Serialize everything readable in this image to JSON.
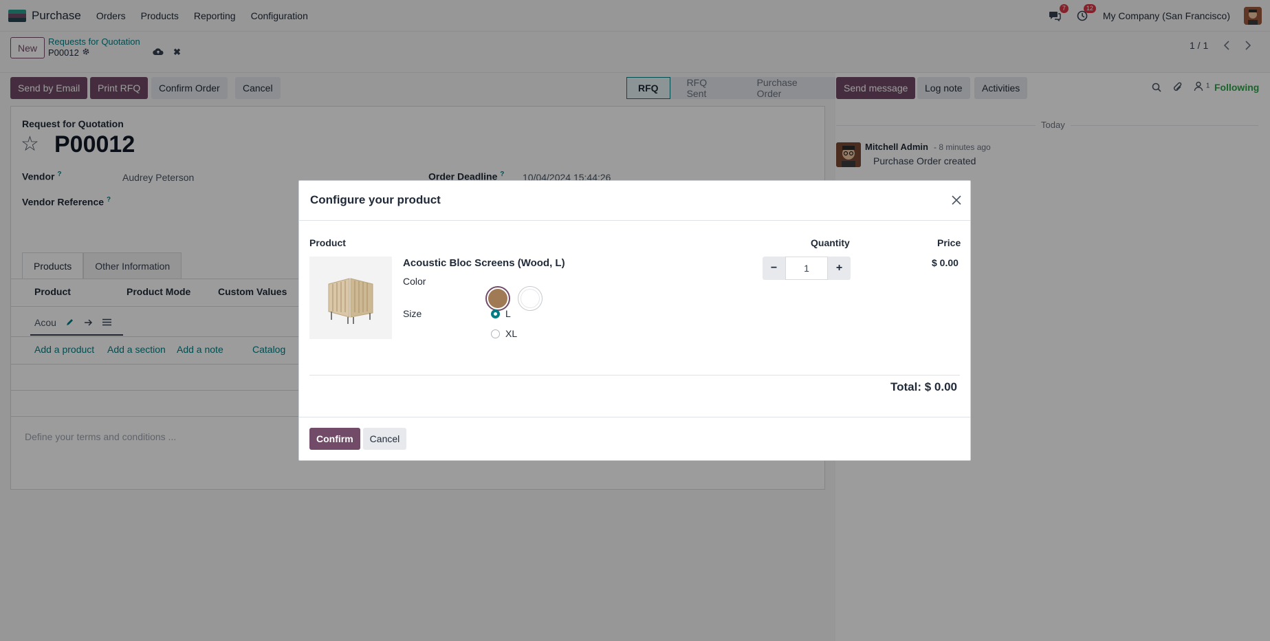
{
  "navbar": {
    "app_name": "Purchase",
    "menu": [
      "Orders",
      "Products",
      "Reporting",
      "Configuration"
    ],
    "messages_badge": "7",
    "activities_badge": "12",
    "company": "My Company (San Francisco)"
  },
  "control_panel": {
    "new_label": "New",
    "breadcrumb_parent": "Requests for Quotation",
    "breadcrumb_current": "P00012",
    "pager": "1 / 1"
  },
  "statusbar": {
    "send_email": "Send by Email",
    "print_rfq": "Print RFQ",
    "confirm_order": "Confirm Order",
    "cancel": "Cancel",
    "stages": [
      "RFQ",
      "RFQ Sent",
      "Purchase Order"
    ],
    "active_stage": "RFQ"
  },
  "form": {
    "doc_type": "Request for Quotation",
    "doc_name": "P00012",
    "vendor_label": "Vendor",
    "vendor_value": "Audrey Peterson",
    "vendor_ref_label": "Vendor Reference",
    "deadline_label": "Order Deadline",
    "deadline_value": "10/04/2024 15:44:26",
    "help_mark": "?",
    "tabs": [
      "Products",
      "Other Information"
    ],
    "columns": [
      "Product",
      "Product Mode",
      "Custom Values"
    ],
    "row_edit_text": "Acou",
    "add_product": "Add a product",
    "add_section": "Add a section",
    "add_note": "Add a note",
    "catalog": "Catalog",
    "terms_placeholder": "Define your terms and conditions ..."
  },
  "chatter": {
    "send_message": "Send message",
    "log_note": "Log note",
    "activities": "Activities",
    "followers_count": "1",
    "following": "Following",
    "today": "Today",
    "author": "Mitchell Admin",
    "time": "- 8 minutes ago",
    "body": "Purchase Order created"
  },
  "dialog": {
    "title": "Configure your product",
    "col_product": "Product",
    "col_quantity": "Quantity",
    "col_price": "Price",
    "product_name": "Acoustic Bloc Screens (Wood, L)",
    "color_label": "Color",
    "size_label": "Size",
    "size_options": [
      "L",
      "XL"
    ],
    "selected_size": "L",
    "quantity": "1",
    "price": "$ 0.00",
    "total": "Total: $ 0.00",
    "confirm": "Confirm",
    "cancel": "Cancel",
    "colors": {
      "wood": "#a07a55",
      "white": "#ffffff"
    }
  }
}
